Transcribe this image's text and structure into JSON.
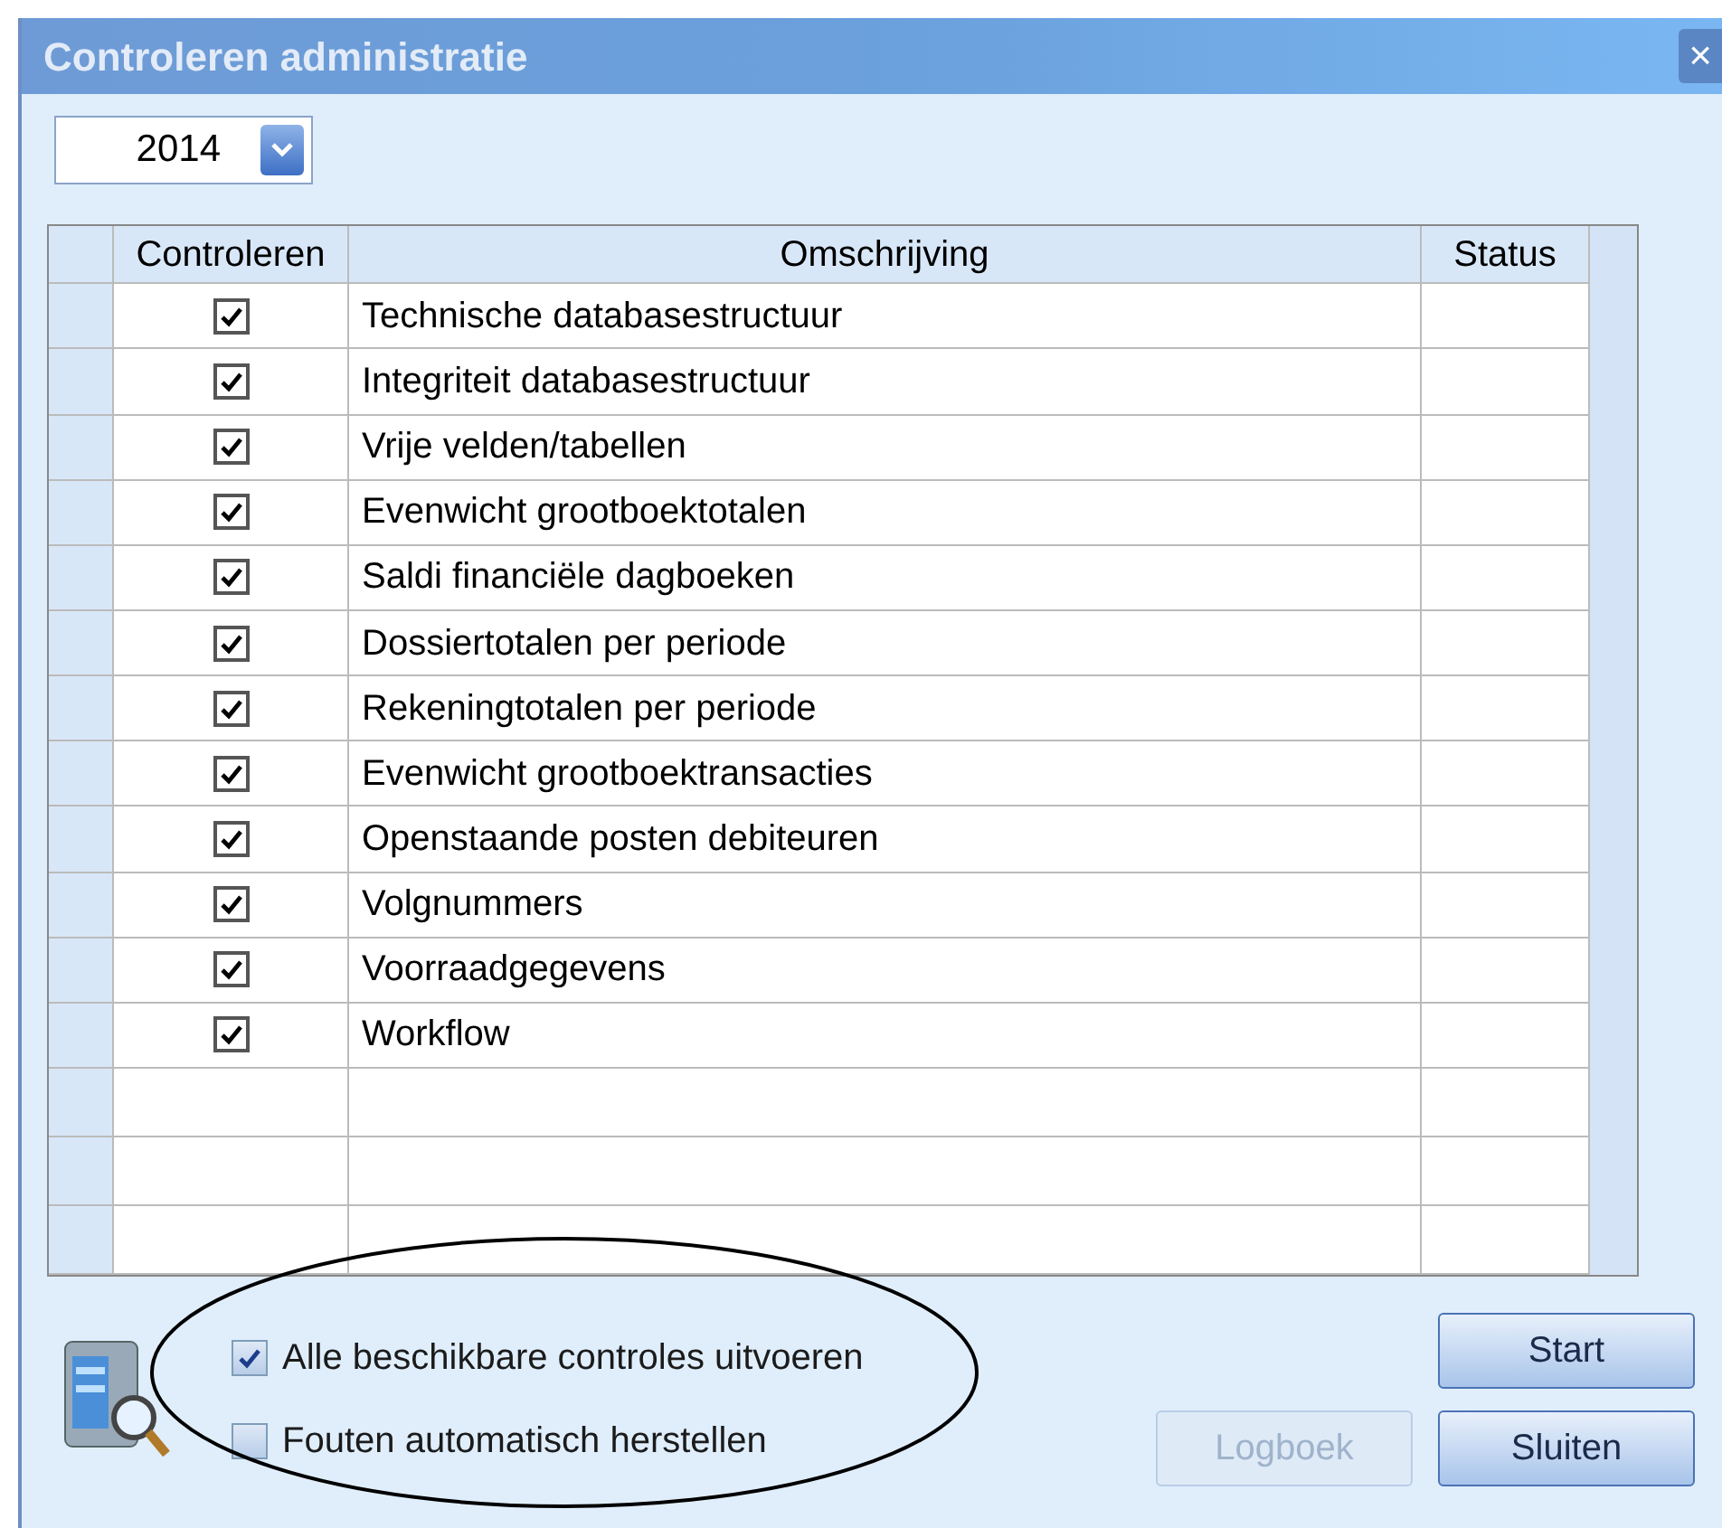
{
  "window": {
    "title": "Controleren administratie",
    "close": "×"
  },
  "year": {
    "value": "2014"
  },
  "table": {
    "columns": [
      "Controleren",
      "Omschrijving",
      "Status"
    ],
    "rows": [
      {
        "checked": true,
        "description": "Technische databasestructuur"
      },
      {
        "checked": true,
        "description": "Integriteit databasestructuur"
      },
      {
        "checked": true,
        "description": "Vrije velden/tabellen"
      },
      {
        "checked": true,
        "description": "Evenwicht grootboektotalen"
      },
      {
        "checked": true,
        "description": "Saldi financiële dagboeken"
      },
      {
        "checked": true,
        "description": "Dossiertotalen per periode"
      },
      {
        "checked": true,
        "description": "Rekeningtotalen per periode"
      },
      {
        "checked": true,
        "description": "Evenwicht grootboektransacties"
      },
      {
        "checked": true,
        "description": "Openstaande posten debiteuren"
      },
      {
        "checked": true,
        "description": "Volgnummers"
      },
      {
        "checked": true,
        "description": "Voorraadgegevens"
      },
      {
        "checked": true,
        "description": "Workflow"
      }
    ]
  },
  "options": [
    {
      "label": "Alle beschikbare controles uitvoeren",
      "checked": true
    },
    {
      "label": "Fouten automatisch herstellen",
      "checked": false
    }
  ],
  "buttons": [
    {
      "label": "Start",
      "disabled": false
    },
    {
      "label": "Logboek",
      "disabled": true
    },
    {
      "label": "Sluiten",
      "disabled": false
    }
  ]
}
